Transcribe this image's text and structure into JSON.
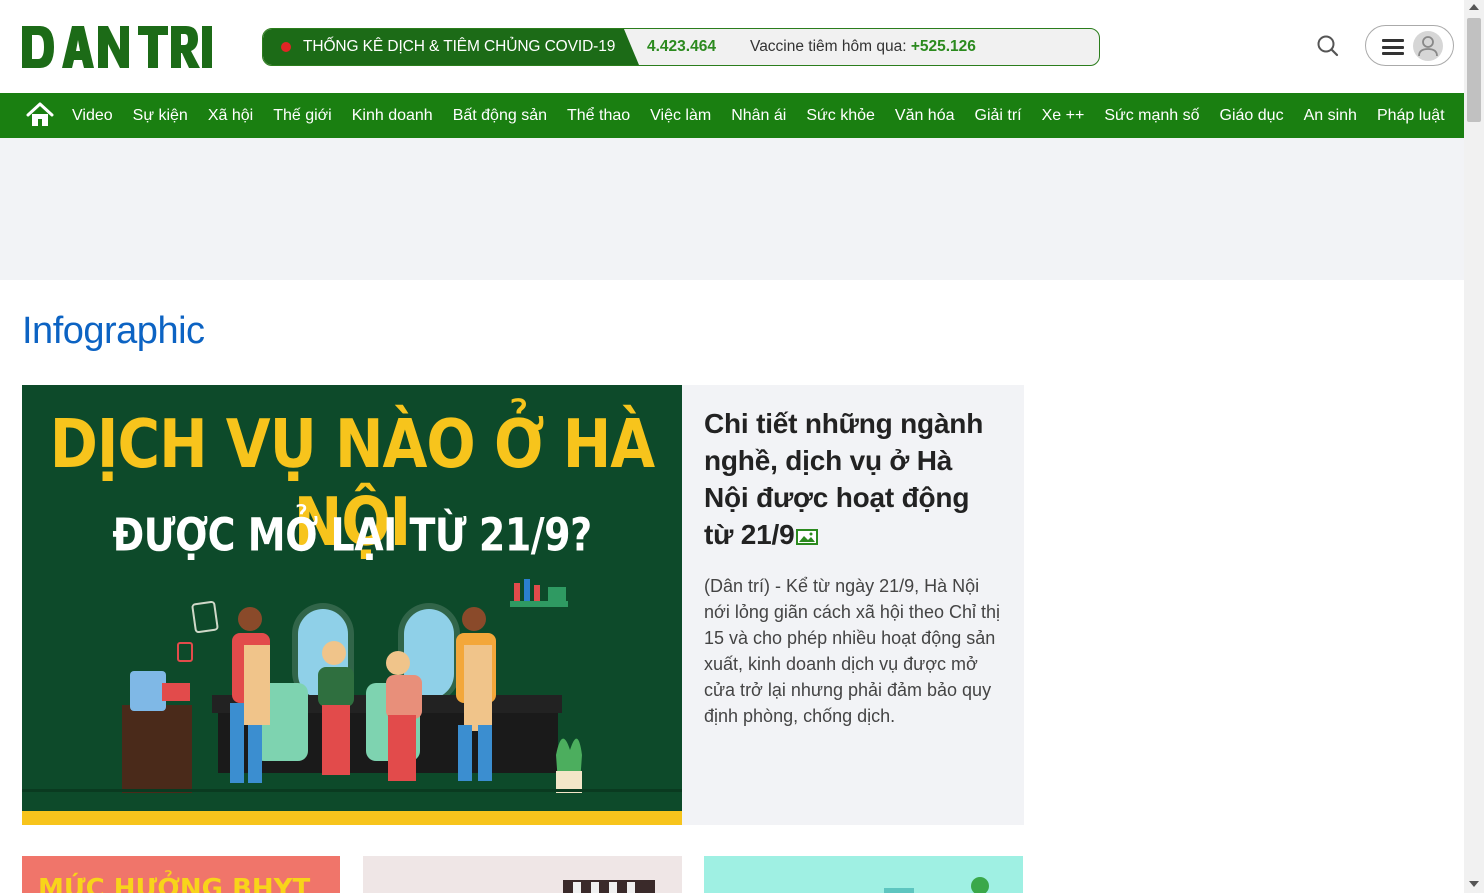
{
  "header": {
    "logo_text": "DÂN TRÍ",
    "covid": {
      "label": "THỐNG KÊ DỊCH & TIÊM CHỦNG COVID-19",
      "count": "4.423.464",
      "vaccine_label": "Vaccine tiêm hôm qua: ",
      "vaccine_value": "+525.126"
    },
    "icons": [
      "search-icon",
      "hamburger-icon",
      "user-avatar-icon"
    ]
  },
  "nav": {
    "home_icon": "home-icon",
    "items": [
      {
        "label": "Video"
      },
      {
        "label": "Sự kiện"
      },
      {
        "label": "Xã hội"
      },
      {
        "label": "Thế giới"
      },
      {
        "label": "Kinh doanh"
      },
      {
        "label": "Bất động sản"
      },
      {
        "label": "Thể thao"
      },
      {
        "label": "Việc làm"
      },
      {
        "label": "Nhân ái"
      },
      {
        "label": "Sức khỏe"
      },
      {
        "label": "Văn hóa"
      },
      {
        "label": "Giải trí"
      },
      {
        "label": "Xe ++"
      },
      {
        "label": "Sức mạnh số"
      },
      {
        "label": "Giáo dục"
      },
      {
        "label": "An sinh"
      },
      {
        "label": "Pháp luật"
      }
    ]
  },
  "section": {
    "title": "Infographic"
  },
  "featured": {
    "image_line1": "DỊCH VỤ NÀO Ở HÀ NỘI",
    "image_line2": "ĐƯỢC MỞ LẠI TỪ 21/9?",
    "headline": "Chi tiết những ngành nghề, dịch vụ ở Hà Nội được hoạt động từ 21/9",
    "sapo": "(Dân trí) - Kể từ ngày 21/9, Hà Nội nới lỏng giãn cách xã hội theo Chỉ thị 15 và cho phép nhiều hoạt động sản xuất, kinh doanh dịch vụ được mở cửa trở lại nhưng phải đảm bảo quy định phòng, chống dịch."
  },
  "cards": [
    {
      "image_text": "MỨC HƯỞNG BHYT"
    }
  ],
  "colors": {
    "brand_green": "#1a7f11",
    "section_blue": "#0c63c3",
    "accent_yellow": "#f7c41c",
    "image_bg": "#0d4a2a"
  }
}
